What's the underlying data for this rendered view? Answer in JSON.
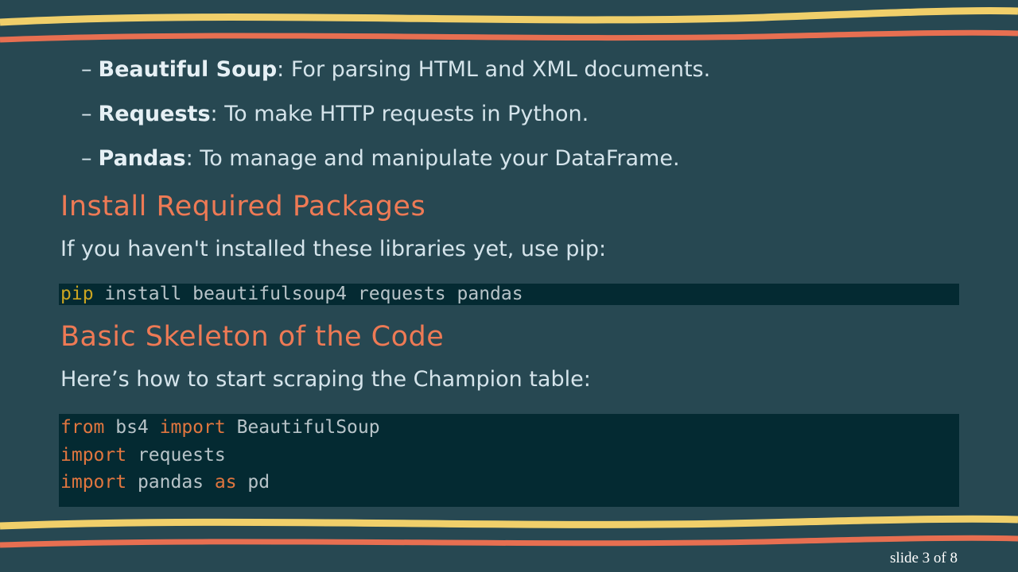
{
  "colors": {
    "background": "#274852",
    "wave_yellow": "#f0cf6a",
    "wave_coral": "#e76f51",
    "heading": "#ee7a55",
    "code_bg": "#042a32",
    "keyword": "#e1763f",
    "command": "#cba521"
  },
  "bullets": [
    {
      "dash": "–",
      "term": "Beautiful Soup",
      "desc": ": For parsing HTML and XML documents."
    },
    {
      "dash": "–",
      "term": "Requests",
      "desc": ": To make HTTP requests in Python."
    },
    {
      "dash": "–",
      "term": "Pandas",
      "desc": ": To manage and manipulate your DataFrame."
    }
  ],
  "section1": {
    "heading": "Install Required Packages",
    "text": "If you haven't installed these libraries yet, use pip:",
    "code": {
      "cmd": "pip",
      "rest": " install beautifulsoup4 requests pandas"
    }
  },
  "section2": {
    "heading": "Basic Skeleton of the Code",
    "text": "Here’s how to start scraping the Champion table:",
    "code_lines": [
      [
        {
          "t": "from",
          "kw": true
        },
        {
          "t": " bs4 "
        },
        {
          "t": "import",
          "kw": true
        },
        {
          "t": " BeautifulSoup"
        }
      ],
      [
        {
          "t": "import",
          "kw": true
        },
        {
          "t": " requests"
        }
      ],
      [
        {
          "t": "import",
          "kw": true
        },
        {
          "t": " pandas "
        },
        {
          "t": "as",
          "kw": true
        },
        {
          "t": " pd"
        }
      ]
    ]
  },
  "footer": {
    "slide": "slide 3 of 8"
  }
}
